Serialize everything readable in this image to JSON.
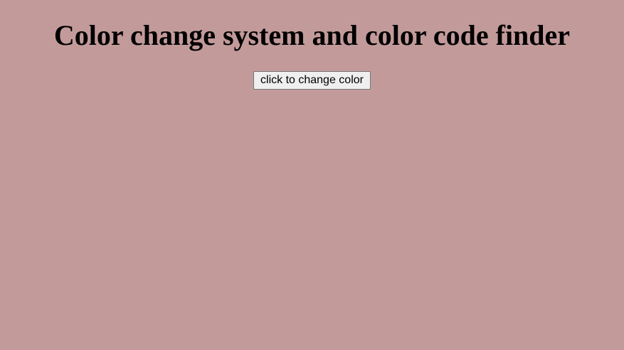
{
  "page": {
    "title": "Color change system and color code finder",
    "background_color": "#c39a9a"
  },
  "controls": {
    "change_color_label": "click to change color"
  }
}
